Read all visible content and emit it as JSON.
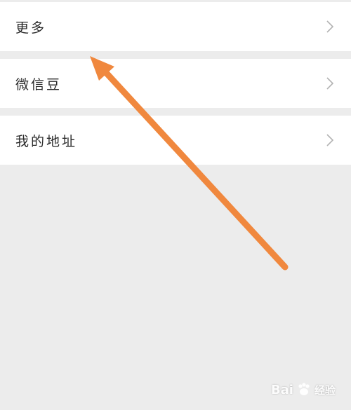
{
  "menu": {
    "items": [
      {
        "label": "更多"
      },
      {
        "label": "微信豆"
      },
      {
        "label": "我的地址"
      }
    ]
  },
  "annotation": {
    "arrow_color": "#f0883e"
  },
  "watermark": {
    "brand": "Bai",
    "brand_suffix": "经验"
  }
}
